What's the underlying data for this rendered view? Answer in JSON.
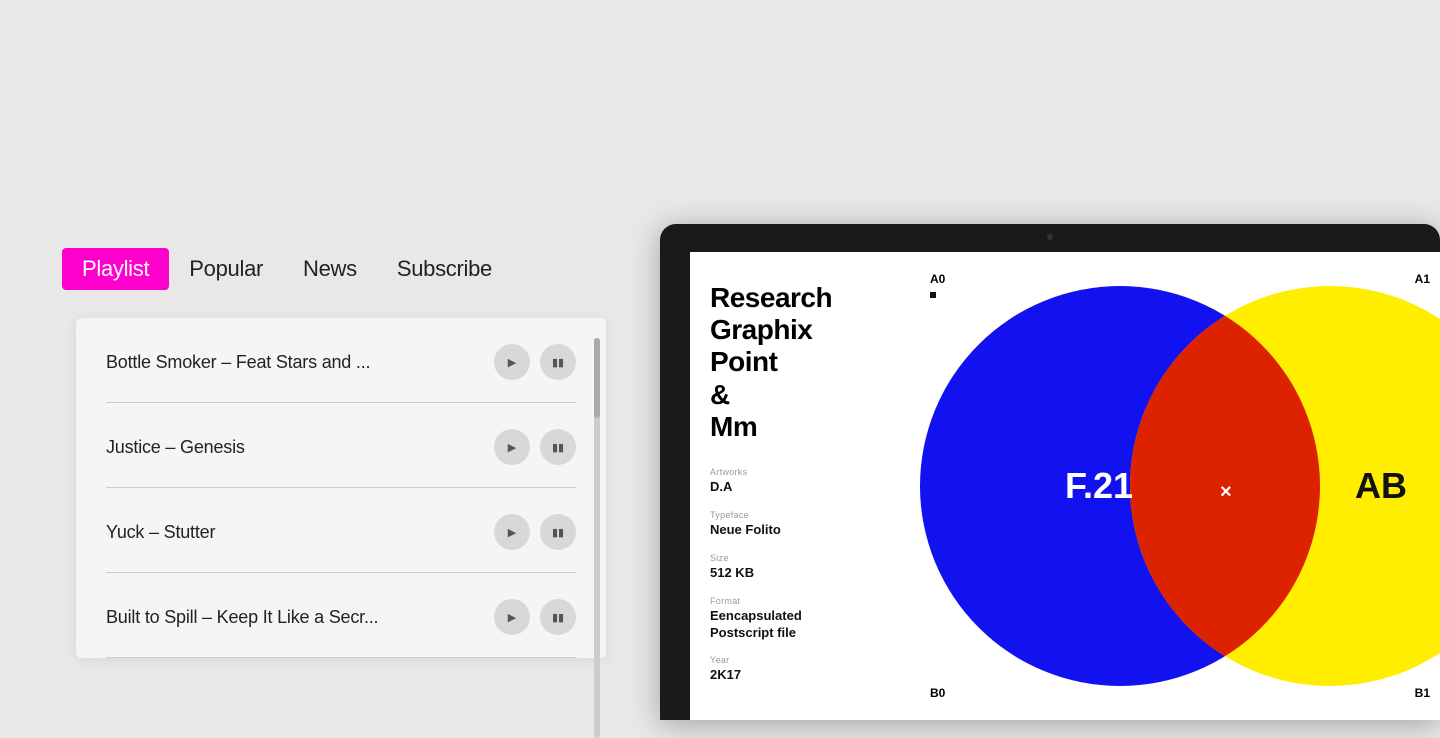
{
  "nav": {
    "tabs": [
      {
        "id": "playlist",
        "label": "Playlist",
        "active": true
      },
      {
        "id": "popular",
        "label": "Popular",
        "active": false
      },
      {
        "id": "news",
        "label": "News",
        "active": false
      },
      {
        "id": "subscribe",
        "label": "Subscribe",
        "active": false
      }
    ]
  },
  "playlist": {
    "items": [
      {
        "title": "Bottle Smoker –  Feat Stars and ..."
      },
      {
        "title": "Justice – Genesis"
      },
      {
        "title": "Yuck – Stutter"
      },
      {
        "title": "Built to Spill – Keep It Like a Secr..."
      }
    ]
  },
  "font_info": {
    "name_line1": "Research",
    "name_line2": "Graphix",
    "name_line3": "Point",
    "name_line4": "&",
    "name_line5": "Mm",
    "artworks_label": "Artworks",
    "artworks_value": "D.A",
    "typeface_label": "Typeface",
    "typeface_value": "Neue Folito",
    "size_label": "Size",
    "size_value": "512 KB",
    "format_label": "Format",
    "format_value_line1": "Eencapsulated",
    "format_value_line2": "Postscript file",
    "year_label": "Year",
    "year_value": "2K17"
  },
  "grid": {
    "a0": "A0",
    "a1": "A1",
    "b0": "B0",
    "b1": "B1",
    "center_label": "F.21",
    "ab_label": "AB",
    "x_label": "×"
  },
  "colors": {
    "accent": "#ff00cc",
    "blue": "#1212f0",
    "yellow": "#ffee00",
    "red": "#dd0000"
  }
}
